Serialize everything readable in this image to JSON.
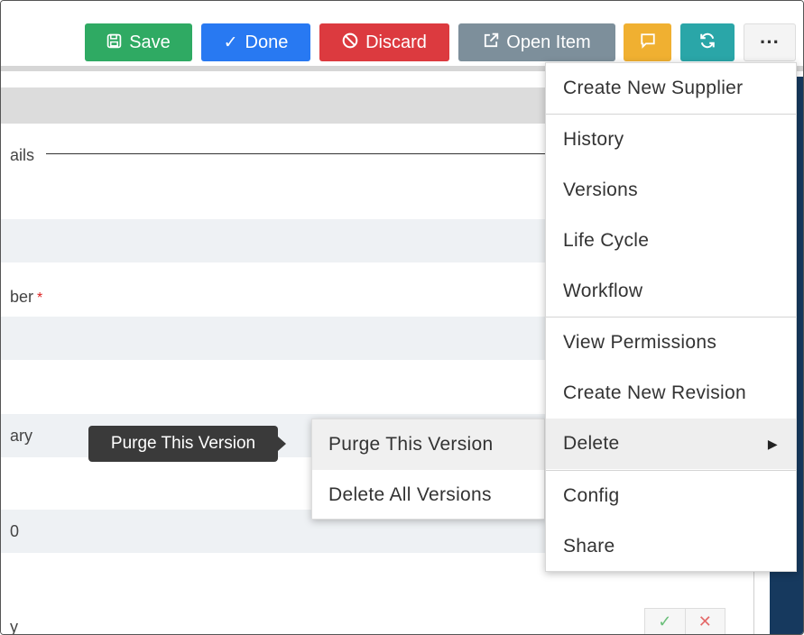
{
  "toolbar": {
    "save_label": "Save",
    "done_label": "Done",
    "discard_label": "Discard",
    "open_item_label": "Open Item",
    "more_label": "···"
  },
  "form": {
    "section_label": "ails",
    "field_1_label": "ber",
    "field_1_required": "*",
    "field_2_label": "ary",
    "field_3_label": "0",
    "field_4_label": "y"
  },
  "menu": {
    "items": [
      {
        "label": "Create New Supplier"
      },
      {
        "label": "History"
      },
      {
        "label": "Versions"
      },
      {
        "label": "Life Cycle"
      },
      {
        "label": "Workflow"
      },
      {
        "label": "View Permissions"
      },
      {
        "label": "Create New Revision"
      },
      {
        "label": "Delete"
      },
      {
        "label": "Config"
      },
      {
        "label": "Share"
      }
    ]
  },
  "submenu": {
    "items": [
      {
        "label": "Purge This Version"
      },
      {
        "label": "Delete All Versions"
      }
    ]
  },
  "tooltip": {
    "text": "Purge This Version"
  },
  "colors": {
    "save": "#2faa63",
    "done": "#2879f2",
    "discard": "#dc3a3f",
    "open_item": "#7d8f9b",
    "comment": "#f0b031",
    "refresh": "#2aa6a8"
  }
}
